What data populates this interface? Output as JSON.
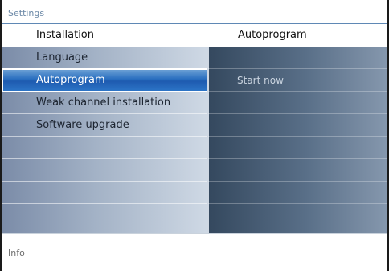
{
  "screen": {
    "title": "Settings",
    "info_label": "Info"
  },
  "header": {
    "left_title": "Installation",
    "right_title": "Autoprogram"
  },
  "menu": {
    "selected_index": 1,
    "items": [
      {
        "label": "Language"
      },
      {
        "label": "Autoprogram"
      },
      {
        "label": "Weak channel installation"
      },
      {
        "label": "Software upgrade"
      },
      {
        "label": ""
      },
      {
        "label": ""
      },
      {
        "label": ""
      },
      {
        "label": ""
      }
    ]
  },
  "submenu": {
    "items": [
      {
        "label": ""
      },
      {
        "label": "Start now"
      },
      {
        "label": ""
      },
      {
        "label": ""
      },
      {
        "label": ""
      },
      {
        "label": ""
      },
      {
        "label": ""
      },
      {
        "label": ""
      }
    ]
  },
  "colors": {
    "accent": "#2a6fc0",
    "title_rule": "#5f88b5"
  }
}
